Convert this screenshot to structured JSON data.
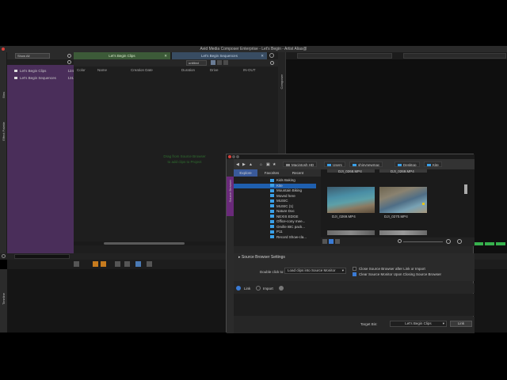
{
  "window": {
    "title": "Avid Media Composer Enterprise - Let's Begin - Artist Alias@"
  },
  "left_strip": {
    "bins_label": "Bins",
    "effect_palette_label": "Effect Palette"
  },
  "bin_pane": {
    "dropdown": "Show All",
    "items": [
      {
        "label": "Let's Begin Clips",
        "size": "124K"
      },
      {
        "label": "Let's Begin Sequences",
        "size": "131K"
      }
    ]
  },
  "clips_panel": {
    "tabs": [
      {
        "label": "Let's Begin Clips"
      },
      {
        "label": "Let's Begin Sequences"
      }
    ],
    "view_dropdown": "untitled",
    "columns": [
      "Color",
      "Name",
      "Creation Date",
      "Duration",
      "Drive",
      "IN-OUT"
    ],
    "drop_hint_line1": "Drag from Source Browser",
    "drop_hint_line2": "to add clips to Project"
  },
  "composer": {
    "label": "Composer"
  },
  "timeline": {
    "label": "Timeline"
  },
  "source_browser": {
    "side_label": "Source Browser",
    "breadcrumbs": [
      "Macintosh HD",
      "Users",
      "shinynewmac",
      "Desktop",
      "Kite"
    ],
    "tabs": [
      "Explore",
      "Favorites",
      "Recent"
    ],
    "tree": [
      {
        "label": "Kids Baking",
        "selected": false
      },
      {
        "label": "Kite",
        "selected": true
      },
      {
        "label": "Mountain Biking",
        "selected": false
      },
      {
        "label": "Moved here",
        "selected": false
      },
      {
        "label": "MUSIC",
        "selected": false
      },
      {
        "label": "MUSIC (1)",
        "selected": false
      },
      {
        "label": "Nature Doc",
        "selected": false
      },
      {
        "label": "NEXIS EDGE",
        "selected": false
      },
      {
        "label": "Office-cony mee...",
        "selected": false
      },
      {
        "label": "Orville IBC pack...",
        "selected": false
      },
      {
        "label": "P11",
        "selected": false
      },
      {
        "label": "Record Show-cla...",
        "selected": false
      }
    ],
    "top_captions": [
      "DJI_0268.MP4",
      "DJI_0269.MP4"
    ],
    "thumbnails": [
      {
        "caption": "DJI_0269.MP4"
      },
      {
        "caption": "DJI_0270.MP4"
      }
    ],
    "settings": {
      "header": "Source Browser Settings",
      "double_click_label": "Double click to:",
      "double_click_value": "Load clips into Source Monitor",
      "close_after_link": "Close Source Browser after Link or Import",
      "clear_monitor": "Clear Source Monitor Upon Closing Source Browser",
      "close_after_link_checked": false,
      "clear_monitor_checked": true
    },
    "mode": {
      "link_label": "Link",
      "import_label": "Import",
      "selected": "Link"
    },
    "footer": {
      "target_label": "Target Bin:",
      "target_value": "Let's Begin Clips",
      "link_button": "Link"
    }
  },
  "colors": {
    "bin_list_bg": "#4a2e5a",
    "clips_tab": "#3c5a38",
    "sequences_tab": "#384c62",
    "source_browser_tab": "#6a2a7a",
    "folder": "#3aa0e8",
    "selection": "#1f5fae",
    "accent_green": "#37b24d"
  }
}
